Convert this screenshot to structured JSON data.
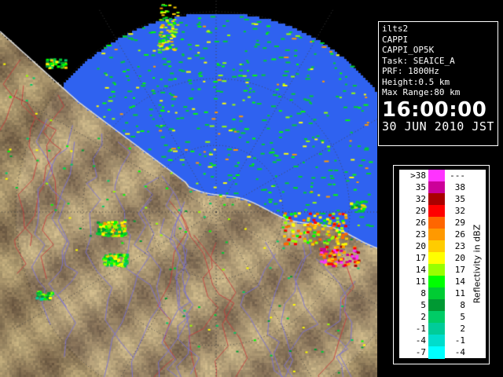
{
  "info": {
    "site": "ilts2",
    "product": "CAPPI",
    "product_name": "CAPPI_OP5K",
    "task": "Task: SEAICE_A",
    "prf": "PRF: 1800Hz",
    "height": "Height:0.5 km",
    "max_range": "Max Range:80 km",
    "time": "16:00:00",
    "date": "30 JUN 2010 JST"
  },
  "legend": {
    "unit_label": "Reflectivity in dBZ",
    "rows": [
      {
        "lo": ">38",
        "hi": "---",
        "color": "#ff33ff"
      },
      {
        "lo": "35",
        "hi": "38",
        "color": "#cc0099"
      },
      {
        "lo": "32",
        "hi": "35",
        "color": "#aa0000"
      },
      {
        "lo": "29",
        "hi": "32",
        "color": "#ff0000"
      },
      {
        "lo": "26",
        "hi": "29",
        "color": "#ff6600"
      },
      {
        "lo": "23",
        "hi": "26",
        "color": "#ff9900"
      },
      {
        "lo": "20",
        "hi": "23",
        "color": "#ffcc00"
      },
      {
        "lo": "17",
        "hi": "20",
        "color": "#ffff00"
      },
      {
        "lo": "14",
        "hi": "17",
        "color": "#99ff00"
      },
      {
        "lo": "11",
        "hi": "14",
        "color": "#00ff00"
      },
      {
        "lo": "8",
        "hi": "11",
        "color": "#00cc33"
      },
      {
        "lo": "5",
        "hi": "8",
        "color": "#009933"
      },
      {
        "lo": "2",
        "hi": "5",
        "color": "#00cc66"
      },
      {
        "lo": "-1",
        "hi": "2",
        "color": "#00cc99"
      },
      {
        "lo": "-4",
        "hi": "-1",
        "color": "#00ddcc"
      },
      {
        "lo": "-7",
        "hi": "-4",
        "color": "#00ffff"
      }
    ]
  },
  "colors": {
    "sea": "#2f62f0",
    "land": "#8a7a5a",
    "outside_range": "#000000"
  }
}
